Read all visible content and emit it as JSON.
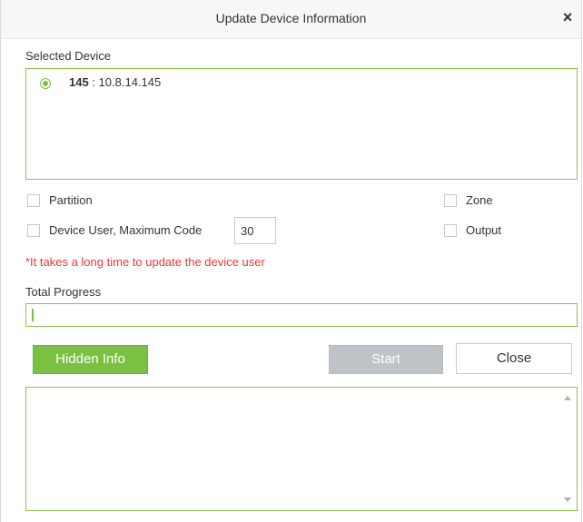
{
  "dialog": {
    "title": "Update Device Information",
    "close_glyph": "×"
  },
  "selected_device": {
    "label": "Selected Device",
    "device_id": "145",
    "separator": " : ",
    "device_ip": "10.8.14.145",
    "selected": true
  },
  "options": {
    "partition": {
      "label": "Partition",
      "checked": false
    },
    "zone": {
      "label": "Zone",
      "checked": false
    },
    "device_user": {
      "label": "Device User, Maximum Code",
      "checked": false,
      "max_code": "30"
    },
    "output": {
      "label": "Output",
      "checked": false
    }
  },
  "warning": "*It takes a long time to update the device user",
  "progress": {
    "label": "Total Progress",
    "percent": 0
  },
  "buttons": {
    "hidden_info": "Hidden Info",
    "start": "Start",
    "close": "Close"
  },
  "log": {
    "text": ""
  },
  "colors": {
    "accent": "#7ac143",
    "border_green": "#8bc34a",
    "warning": "#e53935",
    "disabled": "#bdc3c7"
  },
  "icons": {
    "close": "close-icon",
    "radio": "radio-selected-icon",
    "scroll_up": "scroll-up-arrow-icon",
    "scroll_down": "scroll-down-arrow-icon"
  }
}
